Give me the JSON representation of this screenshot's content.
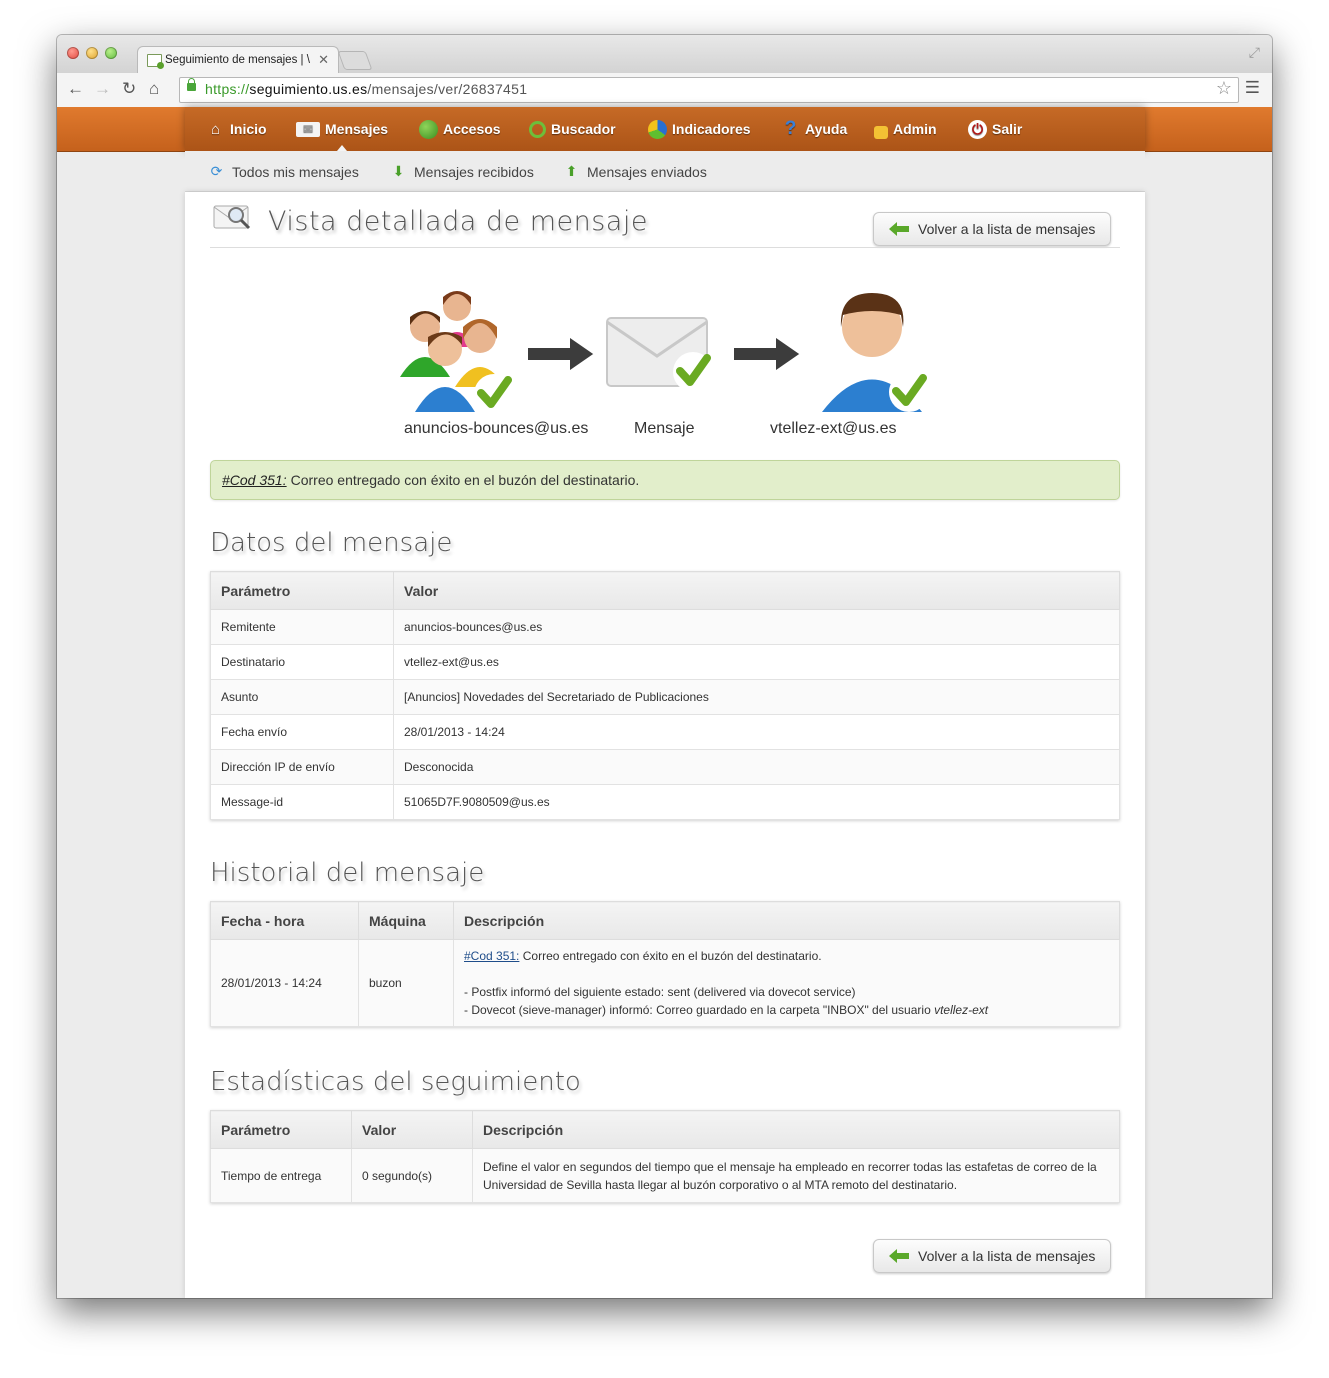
{
  "browser": {
    "tab_title": "Seguimiento de mensajes | \\",
    "url_scheme": "https://",
    "url_host": "seguimiento.us.es",
    "url_path": "/mensajes/ver/26837451"
  },
  "topnav": {
    "items": [
      {
        "label": "Inicio",
        "icon": "home-icon"
      },
      {
        "label": "Mensajes",
        "icon": "envelope-icon"
      },
      {
        "label": "Accesos",
        "icon": "globe-icon"
      },
      {
        "label": "Buscador",
        "icon": "magnifier-icon"
      },
      {
        "label": "Indicadores",
        "icon": "pie-chart-icon"
      },
      {
        "label": "Ayuda",
        "icon": "question-icon"
      },
      {
        "label": "Admin",
        "icon": "padlock-icon"
      },
      {
        "label": "Salir",
        "icon": "power-icon"
      }
    ],
    "active": "Mensajes"
  },
  "subnav": {
    "items": [
      {
        "label": "Todos mis mensajes",
        "icon": "refresh-arrows-icon"
      },
      {
        "label": "Mensajes recibidos",
        "icon": "inbox-download-icon"
      },
      {
        "label": "Mensajes enviados",
        "icon": "outbox-upload-icon"
      }
    ]
  },
  "page": {
    "title": "Vista detallada de mensaje",
    "back_label": "Volver a la lista de mensajes"
  },
  "flow": {
    "sender": "anuncios-bounces@us.es",
    "message": "Mensaje",
    "recipient": "vtellez-ext@us.es"
  },
  "alert": {
    "code": "#Cod 351:",
    "text": "Correo entregado con éxito en el buzón del destinatario."
  },
  "datos": {
    "title": "Datos del mensaje",
    "headers": [
      "Parámetro",
      "Valor"
    ],
    "rows": [
      [
        "Remitente",
        "anuncios-bounces@us.es"
      ],
      [
        "Destinatario",
        "vtellez-ext@us.es"
      ],
      [
        "Asunto",
        "[Anuncios] Novedades del Secretariado de Publicaciones"
      ],
      [
        "Fecha envío",
        "28/01/2013 - 14:24"
      ],
      [
        "Dirección IP de envío",
        "Desconocida"
      ],
      [
        "Message-id",
        "51065D7F.9080509@us.es"
      ]
    ]
  },
  "historial": {
    "title": "Historial del mensaje",
    "headers": [
      "Fecha - hora",
      "Máquina",
      "Descripción"
    ],
    "row": {
      "fecha": "28/01/2013 - 14:24",
      "maquina": "buzon",
      "code": "#Cod 351:",
      "desc_main": "Correo entregado con éxito en el buzón del destinatario.",
      "line1": "- Postfix informó del siguiente estado: sent (delivered via dovecot service)",
      "line2_prefix": "- Dovecot (sieve-manager) informó: Correo guardado en la carpeta \"INBOX\" del usuario",
      "line2_user": "vtellez-ext"
    }
  },
  "estadisticas": {
    "title": "Estadísticas del seguimiento",
    "headers": [
      "Parámetro",
      "Valor",
      "Descripción"
    ],
    "row": {
      "parametro": "Tiempo de entrega",
      "valor": "0 segundo(s)",
      "descripcion": "Define el valor en segundos del tiempo que el mensaje ha empleado en recorrer todas las estafetas de correo de la Universidad de Sevilla hasta llegar al buzón corporativo o al MTA remoto del destinatario."
    }
  },
  "colors": {
    "nav_orange": "#c5611c",
    "alert_green": "#e2eecb",
    "check_green": "#6aaa22"
  }
}
